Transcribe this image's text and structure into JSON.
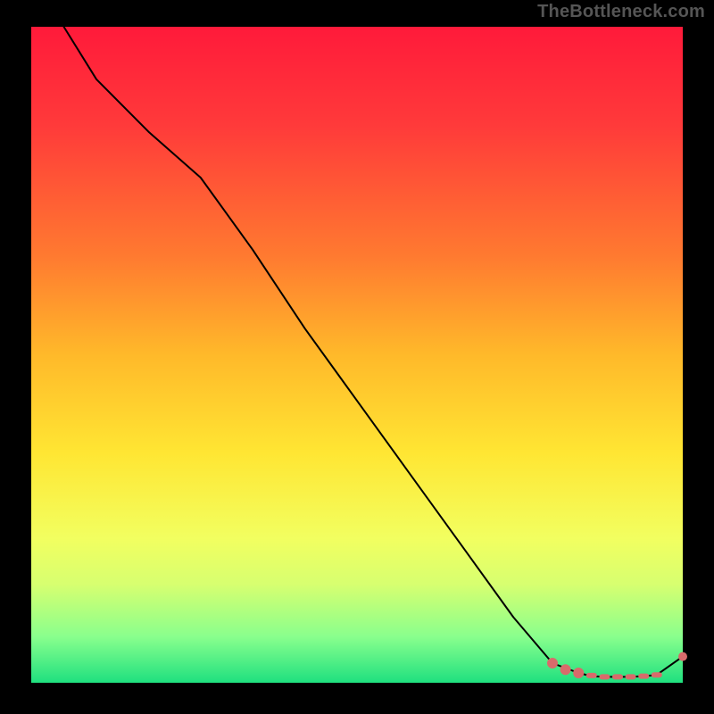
{
  "attribution": "TheBottleneck.com",
  "colors": {
    "page_bg": "#000000",
    "attribution_text": "#555555",
    "curve_stroke": "#000000",
    "marker": "#d86b6b",
    "gradient_stops": [
      "#ff1a3a",
      "#ff3a3a",
      "#ff7a30",
      "#ffb92a",
      "#ffe633",
      "#f2ff60",
      "#d7ff70",
      "#89ff8d",
      "#1fe07f"
    ]
  },
  "chart_data": {
    "type": "line",
    "title": "",
    "xlabel": "",
    "ylabel": "",
    "xlim": [
      0,
      100
    ],
    "ylim": [
      0,
      100
    ],
    "series": [
      {
        "name": "bottleneck-curve",
        "x": [
          5,
          10,
          18,
          26,
          34,
          42,
          50,
          58,
          66,
          74,
          80,
          84,
          86,
          88,
          90,
          92,
          94,
          96,
          100
        ],
        "y": [
          100,
          92,
          84,
          77,
          66,
          54,
          43,
          32,
          21,
          10,
          3,
          1.5,
          1,
          0.9,
          0.9,
          0.9,
          1,
          1.2,
          4
        ]
      }
    ],
    "markers": {
      "name": "bottleneck-markers",
      "x": [
        80,
        82,
        84,
        86,
        88,
        90,
        92,
        94,
        96,
        100
      ],
      "y": [
        3,
        2,
        1.5,
        1.1,
        0.9,
        0.9,
        0.9,
        1.0,
        1.2,
        4
      ],
      "shape": [
        "round",
        "round",
        "round",
        "dash",
        "dash",
        "dash",
        "dash",
        "dash",
        "dash",
        "round"
      ]
    }
  }
}
